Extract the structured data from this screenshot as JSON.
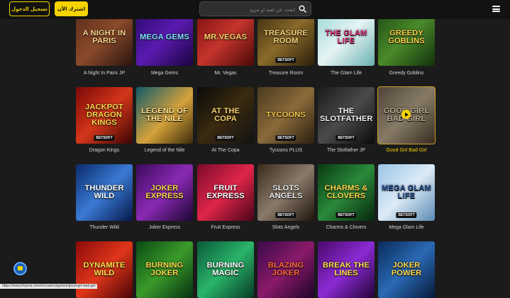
{
  "header": {
    "search_placeholder": "ابحث عن لعبة أو مزود",
    "join_label": "اشترك الآن",
    "login_label": "تسجيل الدخول"
  },
  "colors": {
    "accent": "#f5d400",
    "background": "#1b1b1b",
    "topbar": "#121212"
  },
  "games": [
    {
      "name": "A Night In Paris JP",
      "art": "A Night in Paris",
      "bg": "linear-gradient(135deg,#5a2c1a,#8a4a2a 50%,#2a1410)",
      "fg": "#f7d38a",
      "badge": ""
    },
    {
      "name": "Mega Gems",
      "art": "MEGA GEMS",
      "bg": "linear-gradient(135deg,#2a0a6a,#5a1ab0 50%,#1a0540)",
      "fg": "#7fe0ff",
      "badge": ""
    },
    {
      "name": "Mr. Vegas",
      "art": "Mr.Vegas",
      "bg": "linear-gradient(135deg,#7a0e0e,#c4342c 50%,#4a0808)",
      "fg": "#ffd56a",
      "badge": ""
    },
    {
      "name": "Treasure Room",
      "art": "TREASURE ROOM",
      "bg": "linear-gradient(135deg,#3a2a10,#8a6a2a 50%,#2a1e0a)",
      "fg": "#f0d27a",
      "badge": "BETSOFT"
    },
    {
      "name": "The Glam Life",
      "art": "the Glam LIFE",
      "bg": "linear-gradient(135deg,#9ad6d6,#e6f4f4 50%,#6ab0b0)",
      "fg": "#d4287a",
      "badge": ""
    },
    {
      "name": "Greedy Goblins",
      "art": "Greedy Goblins",
      "bg": "linear-gradient(135deg,#1e4a14,#4a8a2a 50%,#12300c)",
      "fg": "#ffd04a",
      "badge": ""
    },
    {
      "name": "Dragon Kings",
      "art": "JACKPOT DRAGON KINGS",
      "bg": "linear-gradient(135deg,#7a0808,#d4361a 50%,#3a0404)",
      "fg": "#ffd84a",
      "badge": "BETSOFT"
    },
    {
      "name": "Legend of the Nile",
      "art": "Legend of the Nile",
      "bg": "linear-gradient(135deg,#0e5a6a,#d6a23a 55%,#3a2a0a)",
      "fg": "#ffe08a",
      "badge": ""
    },
    {
      "name": "At The Copa",
      "art": "At the Copa",
      "bg": "linear-gradient(135deg,#0a0a0a,#3a2a10 50%,#121212)",
      "fg": "#f2d070",
      "badge": "BETSOFT"
    },
    {
      "name": "Tycoons PLUS",
      "art": "TYCOONS",
      "bg": "linear-gradient(135deg,#4a3a1e,#8a6a3a 50%,#2a1e10)",
      "fg": "#f5c84a",
      "badge": "BETSOFT"
    },
    {
      "name": "The Slotfather JP",
      "art": "THE SLOTFATHER",
      "bg": "linear-gradient(135deg,#1a1a1a,#4a4a4a 50%,#0a0a0a)",
      "fg": "#eeeeee",
      "badge": "BETSOFT"
    },
    {
      "name": "Good Girl Bad Girl",
      "art": "Good Girl Bad Girl",
      "bg": "linear-gradient(135deg,#6a5a4a,#b4a48a 50%,#4a3a2a)",
      "fg": "#f2e0c0",
      "badge": ""
    },
    {
      "name": "Thunder Wild",
      "art": "Thunder Wild",
      "bg": "linear-gradient(135deg,#0a2a6a,#3a7ad4 50%,#06184a)",
      "fg": "#ffffff",
      "badge": ""
    },
    {
      "name": "Joker Express",
      "art": "Joker Express",
      "bg": "linear-gradient(135deg,#3a0a5a,#8a2ab4 50%,#1e0634)",
      "fg": "#ffd84a",
      "badge": ""
    },
    {
      "name": "Fruit Express",
      "art": "Fruit Express",
      "bg": "linear-gradient(135deg,#7a0a2a,#e0264a 50%,#4a0418)",
      "fg": "#ffffff",
      "badge": ""
    },
    {
      "name": "Slots Angels",
      "art": "SLOTS ANGELS",
      "bg": "linear-gradient(135deg,#3a2a1a,#8a7a6a 50%,#1e140a)",
      "fg": "#eeeeee",
      "badge": "BETSOFT"
    },
    {
      "name": "Charms & Clovers",
      "art": "Charms & Clovers",
      "bg": "linear-gradient(135deg,#0a3a14,#2a8a3a 50%,#06240c)",
      "fg": "#ffd84a",
      "badge": "BETSOFT"
    },
    {
      "name": "Mega Glam Life",
      "art": "MEGA GLAM LIFE",
      "bg": "linear-gradient(135deg,#9ac4e6,#dceaf6 50%,#5a8ab4)",
      "fg": "#1e4a8a",
      "badge": "BETSOFT"
    },
    {
      "name": "Dynamite Wild",
      "art": "DYNAMITE WILD",
      "bg": "linear-gradient(135deg,#8a0a0a,#e0361a 50%,#4a0404)",
      "fg": "#ffe04a",
      "badge": ""
    },
    {
      "name": "Burning Joker",
      "art": "Burning Joker",
      "bg": "linear-gradient(135deg,#0a4a14,#3a9a2a 50%,#063010)",
      "fg": "#ffd84a",
      "badge": ""
    },
    {
      "name": "Burning Magic",
      "art": "Burning Magic",
      "bg": "linear-gradient(135deg,#0a5a3a,#2ab46a 50%,#063a24)",
      "fg": "#ffffff",
      "badge": ""
    },
    {
      "name": "Blazing Joker",
      "art": "Blazing Joker",
      "bg": "linear-gradient(135deg,#3a0a4a,#8a1a6a 50%,#1e0428)",
      "fg": "#ff6a3a",
      "badge": ""
    },
    {
      "name": "Break the Lines",
      "art": "Break the Lines",
      "bg": "linear-gradient(135deg,#4a0a6a,#8a2ad4 50%,#240438)",
      "fg": "#ffe04a",
      "badge": ""
    },
    {
      "name": "Joker Power",
      "art": "Joker Power",
      "bg": "linear-gradient(135deg,#0a2a5a,#2a6ab4 50%,#06183a)",
      "fg": "#ffd84a",
      "badge": ""
    }
  ],
  "active_index": 11,
  "status_url": "https://www.freyma.com/en/casino/games/good-girl-bad-girl"
}
